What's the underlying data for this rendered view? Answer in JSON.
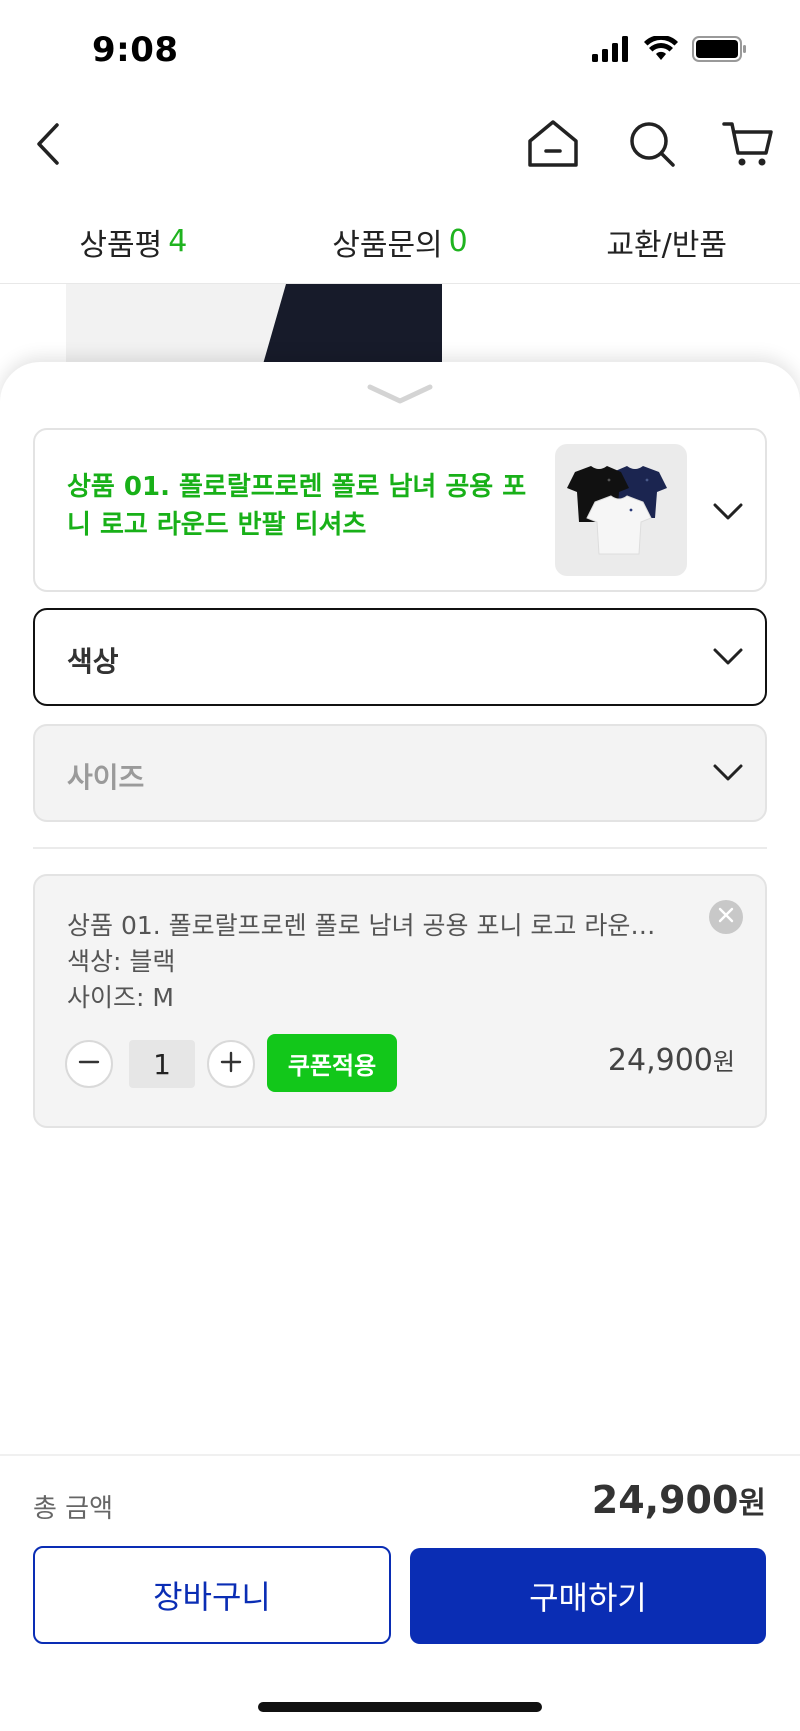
{
  "status": {
    "time": "9:08"
  },
  "tabs": [
    {
      "label": "상품평",
      "count": "4"
    },
    {
      "label": "상품문의",
      "count": "0"
    },
    {
      "label": "교환/반품",
      "count": ""
    }
  ],
  "product": {
    "title": "상품 01. 폴로랄프로렌 폴로 남녀 공용 포니 로고 라운드 반팔 티셔츠"
  },
  "options": {
    "color_label": "색상",
    "size_label": "사이즈"
  },
  "cart_item": {
    "name": "상품 01. 폴로랄프로렌 폴로 남녀 공용 포니 로고 라운드 반팔 티셔츠",
    "color": "색상: 블랙",
    "size": "사이즈: M",
    "quantity": "1",
    "coupon_label": "쿠폰적용",
    "price": "24,900",
    "currency": "원"
  },
  "footer": {
    "total_label": "총 금액",
    "total_value": "24,900",
    "currency": "원",
    "cart_button": "장바구니",
    "buy_button": "구매하기"
  },
  "colors": {
    "accent_green": "#12c71a",
    "primary_blue": "#0a2db4"
  }
}
